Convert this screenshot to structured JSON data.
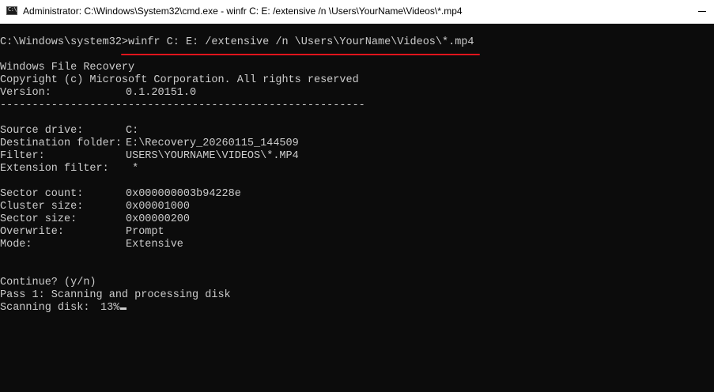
{
  "window": {
    "title": "Administrator: C:\\Windows\\System32\\cmd.exe - winfr  C: E: /extensive /n \\Users\\YourName\\Videos\\*.mp4",
    "app_icon": "cmd-icon",
    "icon_glyph": "C:\\"
  },
  "console": {
    "prompt": "C:\\Windows\\system32>",
    "command": "winfr C: E: /extensive /n \\Users\\YourName\\Videos\\*.mp4",
    "header": {
      "app_name": "Windows File Recovery",
      "copyright": "Copyright (c) Microsoft Corporation. All rights reserved",
      "version_label": "Version:",
      "version_value": "0.1.20151.0",
      "separator": "---------------------------------------------------------"
    },
    "details_1": [
      {
        "label": "Source drive:",
        "value": "C:"
      },
      {
        "label": "Destination folder:",
        "value": "E:\\Recovery_20260115_144509"
      },
      {
        "label": "Filter:",
        "value": "USERS\\YOURNAME\\VIDEOS\\*.MP4"
      },
      {
        "label": "Extension filter:",
        "value": " *"
      }
    ],
    "details_2": [
      {
        "label": "Sector count:",
        "value": "0x000000003b94228e"
      },
      {
        "label": "Cluster size:",
        "value": "0x00001000"
      },
      {
        "label": "Sector size:",
        "value": "0x00000200"
      },
      {
        "label": "Overwrite:",
        "value": "Prompt"
      },
      {
        "label": "Mode:",
        "value": "Extensive"
      }
    ],
    "continue_prompt": "Continue? (y/n)",
    "pass_status": "Pass 1: Scanning and processing disk",
    "scan_label": "Scanning disk:",
    "scan_progress": "13%"
  },
  "colors": {
    "console_bg": "#0c0c0c",
    "console_text": "#cccccc",
    "highlight_underline": "#e0141c",
    "titlebar_bg": "#ffffff"
  }
}
